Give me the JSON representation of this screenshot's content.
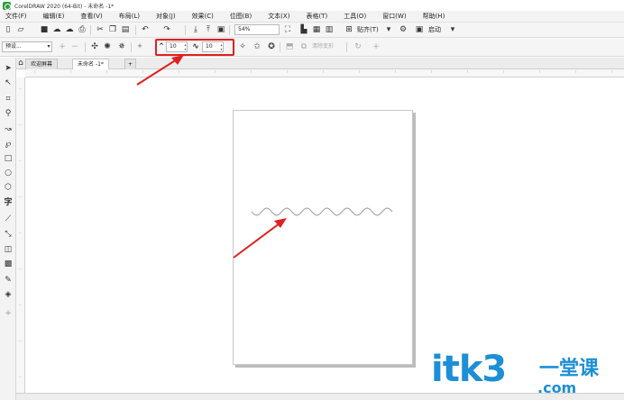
{
  "app": {
    "title": "CorelDRAW 2020 (64-Bit) - 未命名 -1*"
  },
  "menu": {
    "items": [
      "文件(F)",
      "编辑(E)",
      "查看(V)",
      "布局(L)",
      "对象(J)",
      "效果(C)",
      "位图(B)",
      "文本(X)",
      "表格(T)",
      "工具(O)",
      "窗口(W)",
      "帮助(H)"
    ]
  },
  "toolbar": {
    "zoom_value": "54%",
    "snap_label": "贴齐(T)",
    "launch_label": "启动"
  },
  "property_bar": {
    "preset_value": "预设...",
    "wave_frequency": "10",
    "wave_amplitude": "10",
    "clear_distortion_label": "清除变形"
  },
  "tabs": {
    "welcome_label": "欢迎屏幕",
    "document_label": "未命名 -1*",
    "add_label": "+"
  },
  "watermark": {
    "brand": "itk3",
    "cn": "一堂课",
    "domain": ".com"
  },
  "colors": {
    "annotation_red": "#e02020",
    "watermark_blue": "#1d8fd6",
    "wave_stroke": "#9a9a9a"
  }
}
